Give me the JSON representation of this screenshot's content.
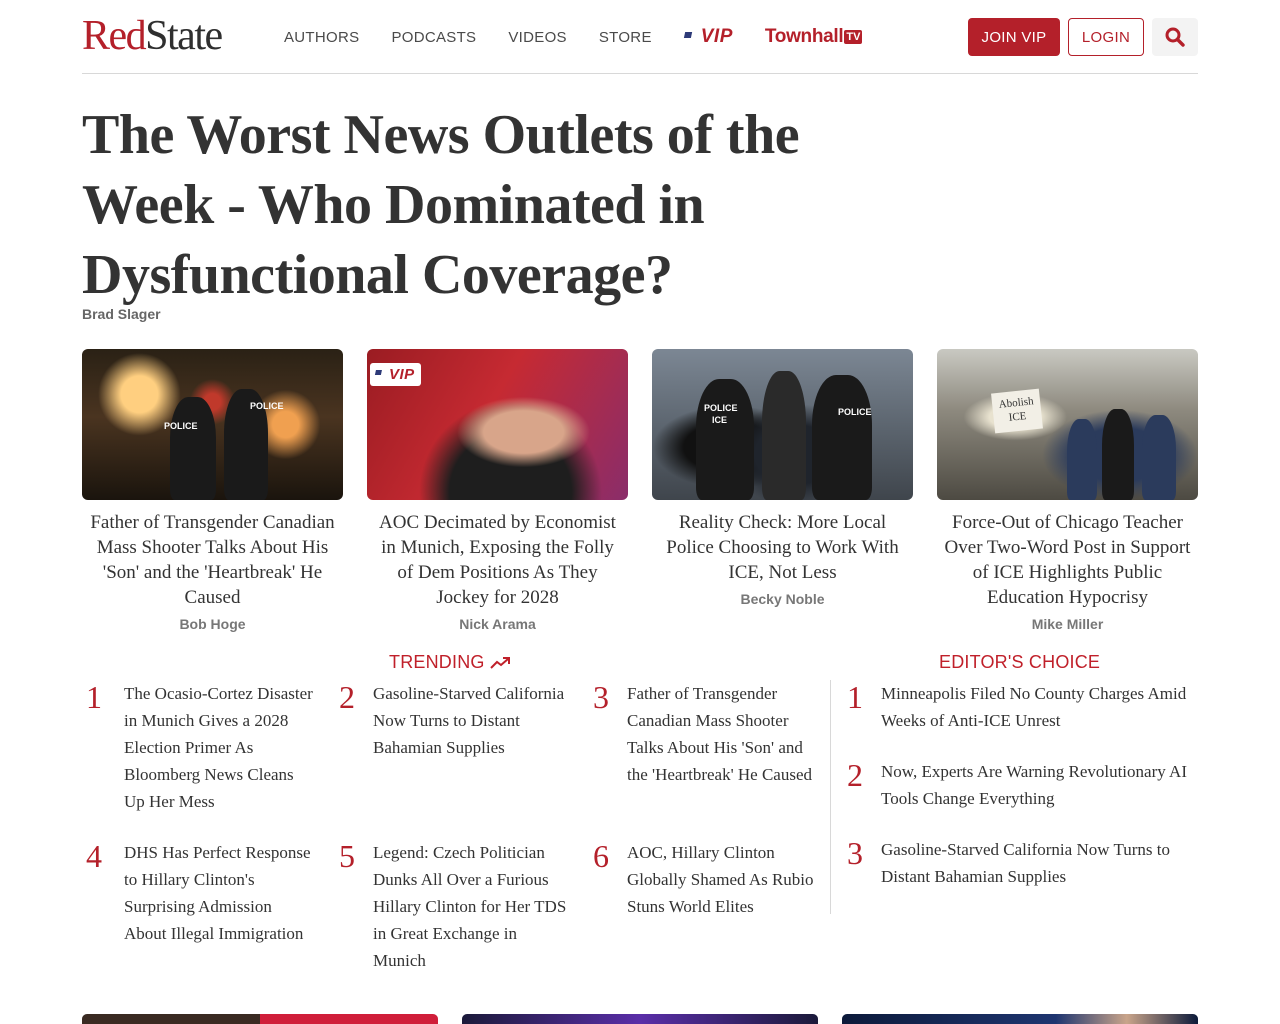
{
  "header": {
    "logo": {
      "part1": "Red",
      "part2": "State"
    },
    "nav": [
      "AUTHORS",
      "PODCASTS",
      "VIDEOS",
      "STORE"
    ],
    "vip_label": "VIP",
    "townhall_label": "Townhall",
    "townhall_tv": "TV",
    "join_label": "JOIN VIP",
    "login_label": "LOGIN"
  },
  "headline": {
    "title": "The Worst News Outlets of the Week - Who Dominated in Dysfunctional Coverage?",
    "author": "Brad Slager"
  },
  "cards": [
    {
      "title": "Father of Transgender Canadian Mass Shooter Talks About His 'Son' and the 'Heartbreak' He Caused",
      "author": "Bob Hoge",
      "vip": false
    },
    {
      "title": "AOC Decimated by Economist in Munich, Exposing the Folly of Dem Positions As They Jockey for 2028",
      "author": "Nick Arama",
      "vip": true,
      "vip_label": "VIP"
    },
    {
      "title": "Reality Check: More Local Police Choosing to Work With ICE, Not Less",
      "author": "Becky Noble",
      "vip": false
    },
    {
      "title": "Force-Out of Chicago Teacher Over Two-Word Post in Support of ICE Highlights Public Education Hypocrisy",
      "author": "Mike Miller",
      "vip": false
    }
  ],
  "image_text": {
    "police": "POLICE",
    "ice": "ICE",
    "sign1": "Abolish",
    "sign2": "ICE"
  },
  "trending": {
    "label": "TRENDING",
    "items": [
      {
        "num": "1",
        "text": "The Ocasio-Cortez Disaster in Munich Gives a 2028 Election Primer As Bloomberg News Cleans Up Her Mess"
      },
      {
        "num": "2",
        "text": "Gasoline-Starved California Now Turns to Distant Bahamian Supplies"
      },
      {
        "num": "3",
        "text": "Father of Transgender Canadian Mass Shooter Talks About His 'Son' and the 'Heartbreak' He Caused"
      },
      {
        "num": "4",
        "text": "DHS Has Perfect Response to Hillary Clinton's Surprising Admission About Illegal Immigration"
      },
      {
        "num": "5",
        "text": "Legend: Czech Politician Dunks All Over a Furious Hillary Clinton for Her TDS in Great Exchange in Munich"
      },
      {
        "num": "6",
        "text": "AOC, Hillary Clinton Globally Shamed As Rubio Stuns World Elites"
      }
    ]
  },
  "editors_choice": {
    "label": "EDITOR'S CHOICE",
    "items": [
      {
        "num": "1",
        "text": "Minneapolis Filed No County Charges Amid Weeks of Anti-ICE Unrest"
      },
      {
        "num": "2",
        "text": "Now, Experts Are Warning Revolutionary AI Tools Change Everything"
      },
      {
        "num": "3",
        "text": "Gasoline-Starved California Now Turns to Distant Bahamian Supplies"
      }
    ]
  },
  "colors": {
    "brand_red": "#b4202a",
    "text": "#333333",
    "muted": "#777777"
  },
  "icons": [
    "search-icon",
    "us-flag-icon",
    "trending-up-icon"
  ]
}
